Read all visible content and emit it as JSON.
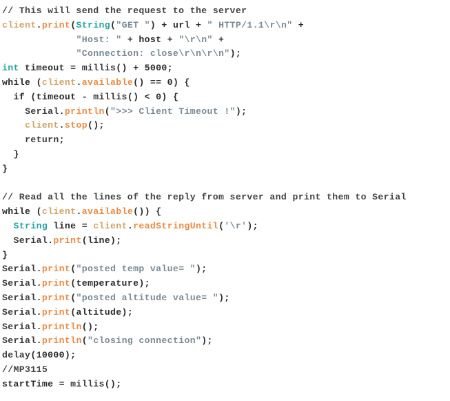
{
  "editor": {
    "language": "arduino-cpp",
    "background_color": "#ffffff",
    "font_size_px": 13,
    "line_height_px": 21,
    "total_lines": 25,
    "palette": {
      "comment": "#434343",
      "keyword": "#27a3a3",
      "type": "#27a3a3",
      "object": "#d2a36a",
      "object_strong": "#e2741e",
      "method": "#eb8b45",
      "function": "#eb8b45",
      "string": "#7b8a96",
      "plain": "#2b2b2b",
      "return_keyword": "#9b9585"
    }
  },
  "code": {
    "plain_text": "// This will send the request to the server\nclient.print(String(\"GET \") + url + \" HTTP/1.1\\r\\n\" +\n             \"Host: \" + host + \"\\r\\n\" +\n             \"Connection: close\\r\\n\\r\\n\");\nint timeout = millis() + 5000;\nwhile (client.available() == 0) {\n  if (timeout - millis() < 0) {\n    Serial.println(\">>> Client Timeout !\");\n    client.stop();\n    return;\n  }\n}\n\n// Read all the lines of the reply from server and print them to Serial\nwhile (client.available()) {\n  String line = client.readStringUntil('\\r');\n  Serial.print(line);\n}\nSerial.print(\"posted temp value= \");\nSerial.print(temperature);\nSerial.print(\"posted altitude value= \");\nSerial.print(altitude);\nSerial.println();\nSerial.println(\"closing connection\");\ndelay(10000);\n//MP3115\nstartTime = millis();",
    "lines": [
      {
        "n": 1,
        "text": "// This will send the request to the server",
        "tokens": [
          {
            "t": "// This will send the request to the server",
            "c": "comment"
          }
        ]
      },
      {
        "n": 2,
        "text": "client.print(String(\"GET \") + url + \" HTTP/1.1\\r\\n\" +",
        "tokens": [
          {
            "t": "client",
            "c": "object"
          },
          {
            "t": ".",
            "c": "plain"
          },
          {
            "t": "print",
            "c": "method"
          },
          {
            "t": "(",
            "c": "plain"
          },
          {
            "t": "String",
            "c": "type"
          },
          {
            "t": "(",
            "c": "plain"
          },
          {
            "t": "\"GET \"",
            "c": "string"
          },
          {
            "t": ") + url + ",
            "c": "plain"
          },
          {
            "t": "\" HTTP/1.1\\r\\n\"",
            "c": "string"
          },
          {
            "t": " +",
            "c": "plain"
          }
        ]
      },
      {
        "n": 3,
        "text": "             \"Host: \" + host + \"\\r\\n\" +",
        "tokens": [
          {
            "t": "             ",
            "c": "plain"
          },
          {
            "t": "\"Host: \"",
            "c": "string"
          },
          {
            "t": " + host + ",
            "c": "plain"
          },
          {
            "t": "\"\\r\\n\"",
            "c": "string"
          },
          {
            "t": " +",
            "c": "plain"
          }
        ]
      },
      {
        "n": 4,
        "text": "             \"Connection: close\\r\\n\\r\\n\");",
        "tokens": [
          {
            "t": "             ",
            "c": "plain"
          },
          {
            "t": "\"Connection: close\\r\\n\\r\\n\"",
            "c": "string"
          },
          {
            "t": ");",
            "c": "plain"
          }
        ]
      },
      {
        "n": 5,
        "text": "int timeout = millis() + 5000;",
        "tokens": [
          {
            "t": "int",
            "c": "type"
          },
          {
            "t": " timeout = ",
            "c": "plain"
          },
          {
            "t": "millis",
            "c": "function"
          },
          {
            "t": "() + 5000;",
            "c": "plain"
          }
        ]
      },
      {
        "n": 6,
        "text": "while (client.available() == 0) {",
        "tokens": [
          {
            "t": "while (",
            "c": "plain"
          },
          {
            "t": "client",
            "c": "object"
          },
          {
            "t": ".",
            "c": "plain"
          },
          {
            "t": "available",
            "c": "method"
          },
          {
            "t": "() == 0) {",
            "c": "plain"
          }
        ]
      },
      {
        "n": 7,
        "text": "  if (timeout - millis() < 0) {",
        "tokens": [
          {
            "t": "  if (timeout - ",
            "c": "plain"
          },
          {
            "t": "millis",
            "c": "function"
          },
          {
            "t": "() < 0) {",
            "c": "plain"
          }
        ]
      },
      {
        "n": 8,
        "text": "    Serial.println(\">>> Client Timeout !\");",
        "tokens": [
          {
            "t": "    ",
            "c": "plain"
          },
          {
            "t": "Serial",
            "c": "object_strong"
          },
          {
            "t": ".",
            "c": "plain"
          },
          {
            "t": "println",
            "c": "method"
          },
          {
            "t": "(",
            "c": "plain"
          },
          {
            "t": "\">>> Client Timeout !\"",
            "c": "string"
          },
          {
            "t": ");",
            "c": "plain"
          }
        ]
      },
      {
        "n": 9,
        "text": "    client.stop();",
        "tokens": [
          {
            "t": "    ",
            "c": "plain"
          },
          {
            "t": "client",
            "c": "object"
          },
          {
            "t": ".",
            "c": "plain"
          },
          {
            "t": "stop",
            "c": "method"
          },
          {
            "t": "();",
            "c": "plain"
          }
        ]
      },
      {
        "n": 10,
        "text": "    return;",
        "tokens": [
          {
            "t": "    ",
            "c": "plain"
          },
          {
            "t": "return",
            "c": "return_keyword"
          },
          {
            "t": ";",
            "c": "plain"
          }
        ]
      },
      {
        "n": 11,
        "text": "  }",
        "tokens": [
          {
            "t": "  }",
            "c": "plain"
          }
        ]
      },
      {
        "n": 12,
        "text": "}",
        "tokens": [
          {
            "t": "}",
            "c": "plain"
          }
        ]
      },
      {
        "n": 13,
        "text": "",
        "tokens": []
      },
      {
        "n": 14,
        "text": "// Read all the lines of the reply from server and print them to Serial",
        "tokens": [
          {
            "t": "// Read all the lines of the reply from server and print them to Serial",
            "c": "comment"
          }
        ]
      },
      {
        "n": 15,
        "text": "while (client.available()) {",
        "tokens": [
          {
            "t": "while (",
            "c": "plain"
          },
          {
            "t": "client",
            "c": "object"
          },
          {
            "t": ".",
            "c": "plain"
          },
          {
            "t": "available",
            "c": "method"
          },
          {
            "t": "()) {",
            "c": "plain"
          }
        ]
      },
      {
        "n": 16,
        "text": "  String line = client.readStringUntil('\\r');",
        "tokens": [
          {
            "t": "  ",
            "c": "plain"
          },
          {
            "t": "String",
            "c": "type"
          },
          {
            "t": " line = ",
            "c": "plain"
          },
          {
            "t": "client",
            "c": "object"
          },
          {
            "t": ".",
            "c": "plain"
          },
          {
            "t": "readStringUntil",
            "c": "method"
          },
          {
            "t": "(",
            "c": "plain"
          },
          {
            "t": "'\\r'",
            "c": "string"
          },
          {
            "t": ");",
            "c": "plain"
          }
        ]
      },
      {
        "n": 17,
        "text": "  Serial.print(line);",
        "tokens": [
          {
            "t": "  ",
            "c": "plain"
          },
          {
            "t": "Serial",
            "c": "object_strong"
          },
          {
            "t": ".",
            "c": "plain"
          },
          {
            "t": "print",
            "c": "method"
          },
          {
            "t": "(line);",
            "c": "plain"
          }
        ]
      },
      {
        "n": 18,
        "text": "}",
        "tokens": [
          {
            "t": "}",
            "c": "plain"
          }
        ]
      },
      {
        "n": 19,
        "text": "Serial.print(\"posted temp value= \");",
        "tokens": [
          {
            "t": "Serial",
            "c": "object_strong"
          },
          {
            "t": ".",
            "c": "plain"
          },
          {
            "t": "print",
            "c": "method"
          },
          {
            "t": "(",
            "c": "plain"
          },
          {
            "t": "\"posted temp value= \"",
            "c": "string"
          },
          {
            "t": ");",
            "c": "plain"
          }
        ]
      },
      {
        "n": 20,
        "text": "Serial.print(temperature);",
        "tokens": [
          {
            "t": "Serial",
            "c": "object_strong"
          },
          {
            "t": ".",
            "c": "plain"
          },
          {
            "t": "print",
            "c": "method"
          },
          {
            "t": "(temperature);",
            "c": "plain"
          }
        ]
      },
      {
        "n": 21,
        "text": "Serial.print(\"posted altitude value= \");",
        "tokens": [
          {
            "t": "Serial",
            "c": "object_strong"
          },
          {
            "t": ".",
            "c": "plain"
          },
          {
            "t": "print",
            "c": "method"
          },
          {
            "t": "(",
            "c": "plain"
          },
          {
            "t": "\"posted altitude value= \"",
            "c": "string"
          },
          {
            "t": ");",
            "c": "plain"
          }
        ]
      },
      {
        "n": 22,
        "text": "Serial.print(altitude);",
        "tokens": [
          {
            "t": "Serial",
            "c": "object_strong"
          },
          {
            "t": ".",
            "c": "plain"
          },
          {
            "t": "print",
            "c": "method"
          },
          {
            "t": "(altitude);",
            "c": "plain"
          }
        ]
      },
      {
        "n": 23,
        "text": "Serial.println();",
        "tokens": [
          {
            "t": "Serial",
            "c": "object_strong"
          },
          {
            "t": ".",
            "c": "plain"
          },
          {
            "t": "println",
            "c": "method"
          },
          {
            "t": "();",
            "c": "plain"
          }
        ]
      },
      {
        "n": 24,
        "text": "Serial.println(\"closing connection\");",
        "tokens": [
          {
            "t": "Serial",
            "c": "object_strong"
          },
          {
            "t": ".",
            "c": "plain"
          },
          {
            "t": "println",
            "c": "method"
          },
          {
            "t": "(",
            "c": "plain"
          },
          {
            "t": "\"closing connection\"",
            "c": "string"
          },
          {
            "t": ");",
            "c": "plain"
          }
        ]
      },
      {
        "n": 25,
        "text": "delay(10000);",
        "tokens": [
          {
            "t": "delay",
            "c": "function"
          },
          {
            "t": "(10000);",
            "c": "plain"
          }
        ]
      },
      {
        "n": 26,
        "text": "//MP3115",
        "tokens": [
          {
            "t": "//MP3115",
            "c": "comment"
          }
        ]
      },
      {
        "n": 27,
        "text": "startTime = millis();",
        "tokens": [
          {
            "t": "startTime = ",
            "c": "plain"
          },
          {
            "t": "millis",
            "c": "function"
          },
          {
            "t": "();",
            "c": "plain"
          }
        ]
      }
    ]
  }
}
